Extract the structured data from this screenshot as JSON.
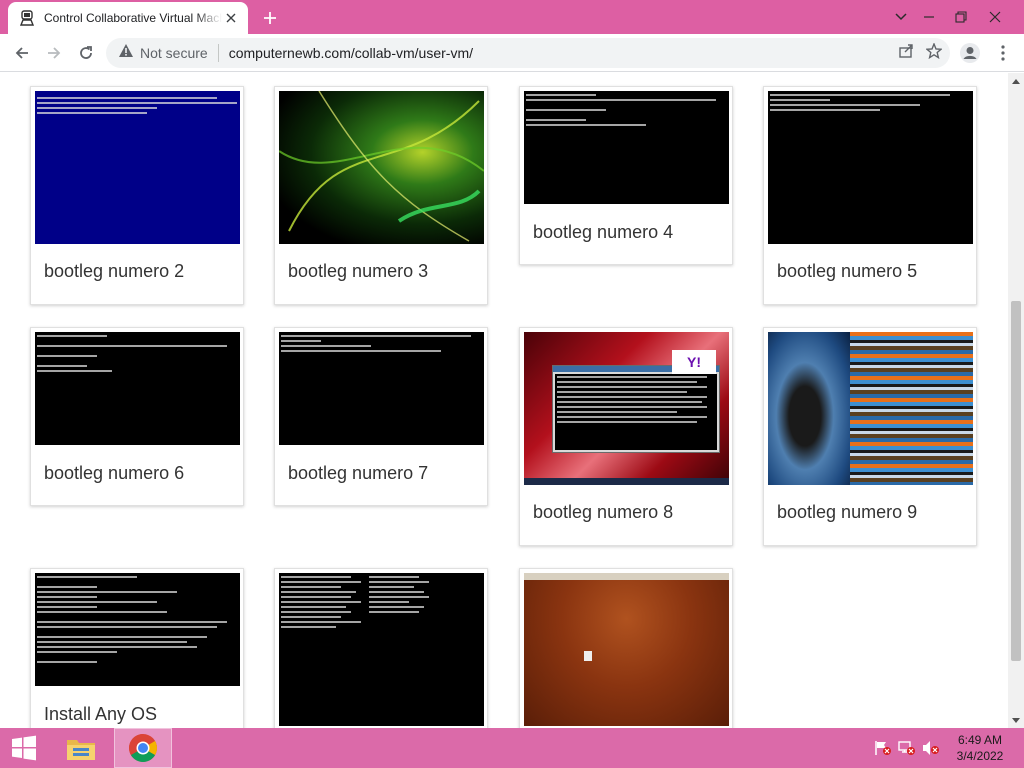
{
  "browser": {
    "tab": {
      "title": "Control Collaborative Virtual Machines"
    },
    "address_bar": {
      "security_label": "Not secure",
      "url": "computernewb.com/collab-vm/user-vm/"
    }
  },
  "vm_cards": [
    {
      "label": "bootleg numero 2",
      "screen": "blue-error-screen"
    },
    {
      "label": "bootleg numero 3",
      "screen": "green-abstract-wallpaper"
    },
    {
      "label": "bootleg numero 4",
      "screen": "boot-console"
    },
    {
      "label": "bootleg numero 5",
      "screen": "boot-console"
    },
    {
      "label": "bootleg numero 6",
      "screen": "boot-console"
    },
    {
      "label": "bootleg numero 7",
      "screen": "boot-console"
    },
    {
      "label": "bootleg numero 8",
      "screen": "red-desktop-with-console-window"
    },
    {
      "label": "bootleg numero 9",
      "screen": "glitched-desktop"
    },
    {
      "label": "Install Any OS",
      "screen": "network-boot-console"
    },
    {
      "label": "",
      "screen": "text-listing-console"
    },
    {
      "label": "",
      "screen": "orange-desktop"
    }
  ],
  "taskbar": {
    "clock": {
      "time": "6:49 AM",
      "date": "3/4/2022"
    }
  },
  "colors": {
    "tab_strip": "#dd5fa3",
    "taskbar": "#db6aa9",
    "card_label": "#333333",
    "error_blue": "#000088"
  }
}
